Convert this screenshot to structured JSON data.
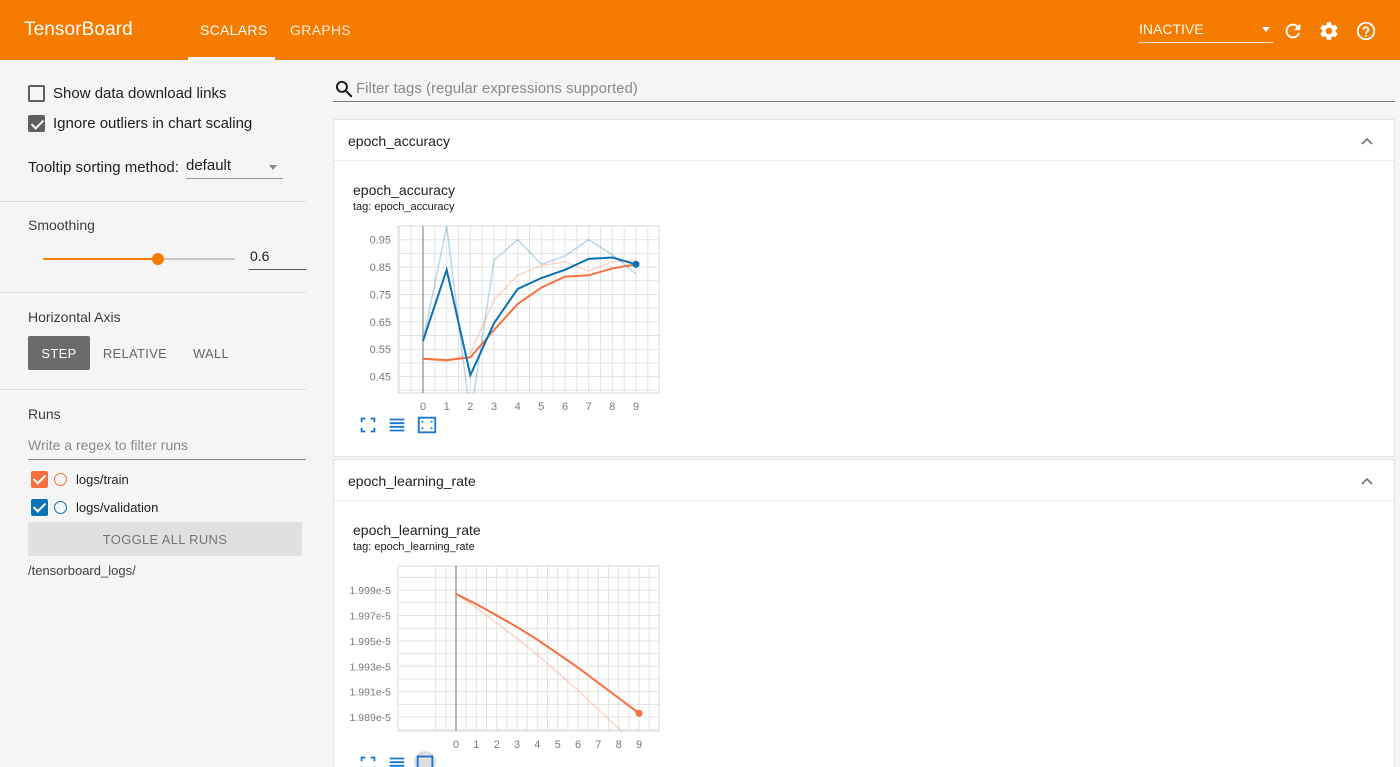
{
  "app": {
    "brand": "TensorBoard",
    "tabs": [
      {
        "label": "SCALARS",
        "active": true
      },
      {
        "label": "GRAPHS",
        "active": false
      }
    ],
    "status": "INACTIVE",
    "icons": [
      "reload-icon",
      "settings-icon",
      "help-icon"
    ],
    "accent_color": "#f57c00"
  },
  "sidebar": {
    "show_download_links": {
      "label": "Show data download links",
      "checked": false
    },
    "ignore_outliers": {
      "label": "Ignore outliers in chart scaling",
      "checked": true
    },
    "tooltip_sort": {
      "label": "Tooltip sorting method:",
      "value": "default"
    },
    "smoothing": {
      "title": "Smoothing",
      "value": "0.6",
      "fraction": 0.6
    },
    "horizontal_axis": {
      "title": "Horizontal Axis",
      "options": [
        {
          "label": "STEP",
          "active": true
        },
        {
          "label": "RELATIVE",
          "active": false
        },
        {
          "label": "WALL",
          "active": false
        }
      ]
    },
    "runs": {
      "title": "Runs",
      "filter_placeholder": "Write a regex to filter runs",
      "items": [
        {
          "label": "logs/train",
          "color": "#f4703e",
          "checked": true
        },
        {
          "label": "logs/validation",
          "color": "#0b72b4",
          "checked": true
        }
      ],
      "toggle_label": "TOGGLE ALL RUNS",
      "log_dir": "/tensorboard_logs/"
    }
  },
  "main": {
    "search_placeholder": "Filter tags (regular expressions supported)",
    "panels": [
      {
        "header": "epoch_accuracy",
        "card_title": "epoch_accuracy",
        "card_tag": "tag: epoch_accuracy"
      },
      {
        "header": "epoch_learning_rate",
        "card_title": "epoch_learning_rate",
        "card_tag": "tag: epoch_learning_rate"
      }
    ]
  },
  "chart_data": [
    {
      "type": "line",
      "title": "epoch_accuracy",
      "x": [
        0,
        1,
        2,
        3,
        4,
        5,
        6,
        7,
        8,
        9
      ],
      "x_tick_labels": [
        "0",
        "1",
        "2",
        "3",
        "4",
        "5",
        "6",
        "7",
        "8",
        "9"
      ],
      "y_tick_values": [
        0.45,
        0.55,
        0.65,
        0.75,
        0.85,
        0.95
      ],
      "y_tick_labels": [
        "0.45",
        "0.55",
        "0.65",
        "0.75",
        "0.85",
        "0.95"
      ],
      "ylim": [
        0.39,
        1.0
      ],
      "grid": true,
      "series": [
        {
          "name": "logs/train",
          "color": "#f4703e",
          "smoothed": true,
          "values": [
            0.515,
            0.51,
            0.52,
            0.62,
            0.715,
            0.775,
            0.815,
            0.82,
            0.845,
            0.86
          ],
          "raw": [
            0.515,
            0.505,
            0.535,
            0.73,
            0.82,
            0.855,
            0.87,
            0.835,
            0.87,
            0.875
          ]
        },
        {
          "name": "logs/validation",
          "color": "#0b72b4",
          "smoothed": true,
          "values": [
            0.58,
            0.84,
            0.455,
            0.645,
            0.77,
            0.81,
            0.84,
            0.88,
            0.885,
            0.86
          ],
          "raw": [
            0.58,
            1.0,
            0.3,
            0.875,
            0.95,
            0.86,
            0.89,
            0.95,
            0.895,
            0.825
          ]
        }
      ]
    },
    {
      "type": "line",
      "title": "epoch_learning_rate",
      "x": [
        0,
        1,
        2,
        3,
        4,
        5,
        6,
        7,
        8,
        9
      ],
      "x_tick_labels": [
        "0",
        "1",
        "2",
        "3",
        "4",
        "5",
        "6",
        "7",
        "8",
        "9"
      ],
      "y_tick_values": [
        1.989e-05,
        1.991e-05,
        1.993e-05,
        1.995e-05,
        1.997e-05,
        1.999e-05
      ],
      "y_tick_labels": [
        "1.989e-5",
        "1.991e-5",
        "1.993e-5",
        "1.995e-5",
        "1.997e-5",
        "1.999e-5"
      ],
      "ylim": [
        1.9879e-05,
        2.0009e-05
      ],
      "grid": true,
      "series": [
        {
          "name": "logs/train",
          "color": "#f4703e",
          "smoothed": true,
          "values": [
            1.9987e-05,
            1.9979e-05,
            1.997e-05,
            1.9961e-05,
            1.9951e-05,
            1.994e-05,
            1.9929e-05,
            1.9917e-05,
            1.9905e-05,
            1.9893e-05
          ],
          "raw": [
            1.9987e-05,
            1.9976e-05,
            1.9964e-05,
            1.9952e-05,
            1.9939e-05,
            1.9925e-05,
            1.9911e-05,
            1.9896e-05,
            1.9881e-05,
            1.9866e-05
          ]
        }
      ]
    }
  ]
}
